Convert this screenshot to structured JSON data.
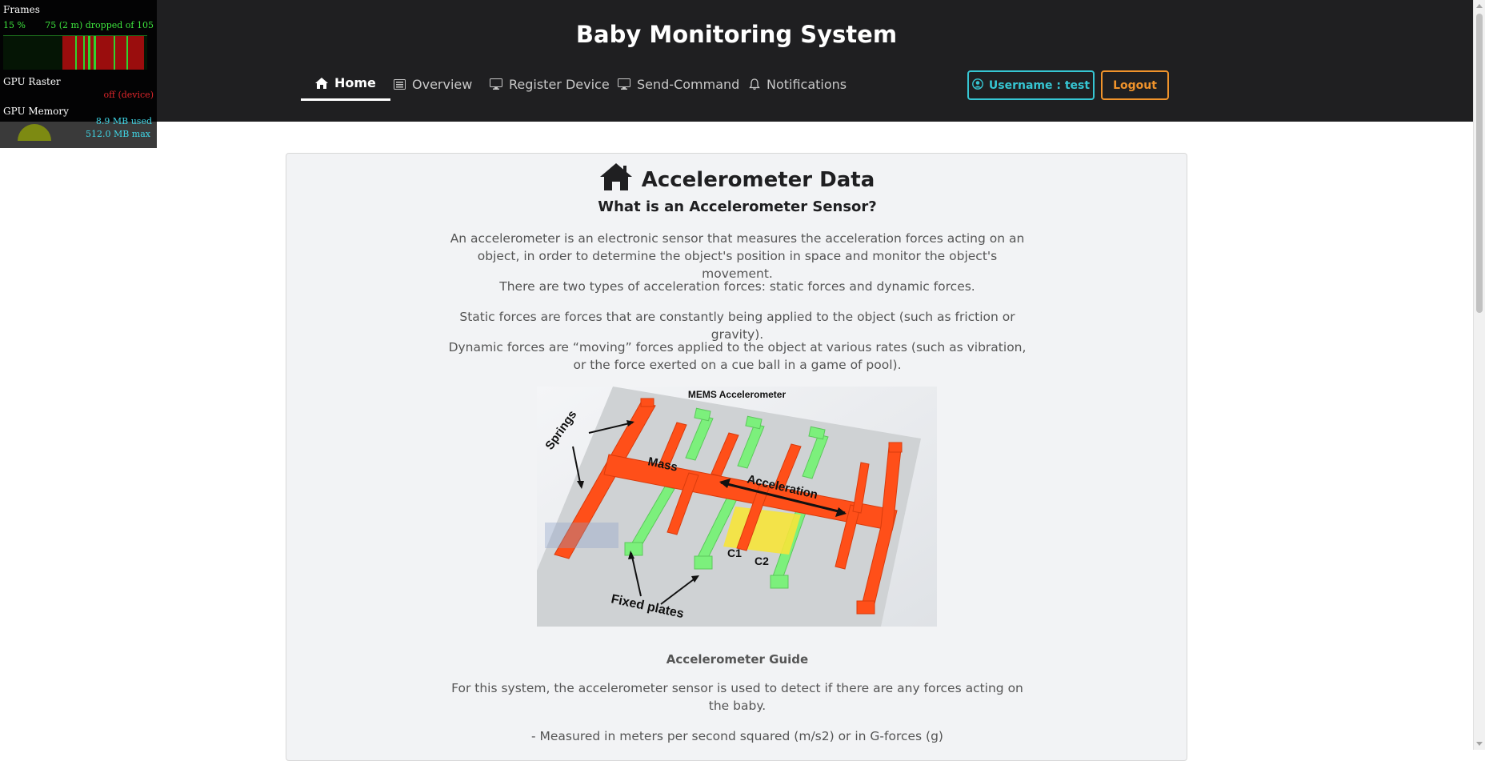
{
  "app": {
    "title": "Baby Monitoring System"
  },
  "nav": {
    "items": [
      {
        "label": "Home",
        "icon": "home-icon",
        "active": true
      },
      {
        "label": "Overview",
        "icon": "list-icon",
        "active": false
      },
      {
        "label": "Register Device",
        "icon": "monitor-icon",
        "active": false
      },
      {
        "label": "Send-Command",
        "icon": "monitor-icon",
        "active": false
      },
      {
        "label": "Notifications",
        "icon": "bell-icon",
        "active": false
      }
    ]
  },
  "user": {
    "label": "Username : test",
    "icon": "user-circle-icon"
  },
  "logout": {
    "label": "Logout"
  },
  "fps_overlay": {
    "frames_label": "Frames",
    "frames_percent": "15 %",
    "frames_dropped": "75 (2 m) dropped of 105",
    "gpu_raster_label": "GPU Raster",
    "gpu_raster_status": "off (device)",
    "gpu_memory_label": "GPU Memory",
    "gpu_memory_used": "8.9 MB used",
    "gpu_memory_max": "512.0 MB max"
  },
  "card": {
    "icon": "home-icon",
    "title": "Accelerometer Data",
    "subtitle": "What is an Accelerometer Sensor?",
    "paragraphs": [
      "An accelerometer is an electronic sensor that measures the acceleration forces acting on an object, in order to determine the object's position in space and monitor the object's movement.",
      "There are two types of acceleration forces: static forces and dynamic forces.",
      "Static forces are forces that are constantly being applied to the object (such as friction or gravity).",
      "Dynamic forces are “moving” forces applied to the object at various rates (such as vibration, or the force exerted on a cue ball in a game of pool)."
    ],
    "diagram": {
      "title": "MEMS Accelerometer",
      "labels": {
        "springs": "Springs",
        "mass": "Mass",
        "acceleration": "Acceleration",
        "c1": "C1",
        "c2": "C2",
        "fixed_plates": "Fixed plates"
      },
      "colors": {
        "mass": "#ff4f19",
        "fixed_plates": "#7cf07c",
        "capacitor": "#f6e43a",
        "base": "#cfd2d4"
      }
    },
    "guide_heading": "Accelerometer Guide",
    "guide_paragraphs": [
      "For this system, the accelerometer sensor is used to detect if there are any forces acting on the baby.",
      "- Measured in meters per second squared (m/s2) or in G-forces (g)"
    ]
  }
}
